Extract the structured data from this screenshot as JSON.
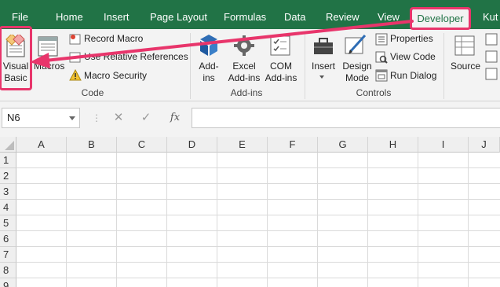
{
  "tabs": [
    "File",
    "Home",
    "Insert",
    "Page Layout",
    "Formulas",
    "Data",
    "Review",
    "View",
    "Developer",
    "Kut"
  ],
  "ribbon": {
    "code_group": {
      "label": "Code",
      "visual_basic": "Visual Basic",
      "visual_basic_line1": "Visual",
      "visual_basic_line2": "Basic",
      "macros": "Macros",
      "record_macro": "Record Macro",
      "use_relative_references": "Use Relative References",
      "macro_security": "Macro Security"
    },
    "addins_group": {
      "label": "Add-ins",
      "addins_line1": "Add-",
      "addins_line2": "ins",
      "excel_addins_line1": "Excel",
      "excel_addins_line2": "Add-ins",
      "com_addins_line1": "COM",
      "com_addins_line2": "Add-ins"
    },
    "controls_group": {
      "label": "Controls",
      "insert": "Insert",
      "design_mode_line1": "Design",
      "design_mode_line2": "Mode",
      "properties": "Properties",
      "view_code": "View Code",
      "run_dialog": "Run Dialog"
    },
    "xml_group": {
      "source": "Source"
    }
  },
  "formula_bar": {
    "name_box": "N6",
    "cancel_glyph": "✕",
    "enter_glyph": "✓",
    "fx_label": "fx",
    "formula": ""
  },
  "grid": {
    "columns": [
      "A",
      "B",
      "C",
      "D",
      "E",
      "F",
      "G",
      "H",
      "I",
      "J"
    ],
    "rows": [
      "1",
      "2",
      "3",
      "4",
      "5",
      "6",
      "7",
      "8",
      "9"
    ]
  },
  "colors": {
    "tab_bar": "#217346",
    "highlight": "#e8356b",
    "ribbon_bg": "#f3f3f3"
  },
  "icons": {
    "visual_basic": "vba-editor-icon",
    "macros": "macros-icon",
    "record_macro": "record-macro-icon",
    "relative_refs": "relative-references-icon",
    "macro_security": "warning-icon",
    "addins": "addins-icon",
    "excel_addins": "gear-icon",
    "com_addins": "com-addins-icon",
    "insert_controls": "toolbox-icon",
    "design_mode": "design-mode-icon",
    "properties": "properties-icon",
    "view_code": "view-code-icon",
    "run_dialog": "run-dialog-icon",
    "source": "xml-source-icon"
  }
}
